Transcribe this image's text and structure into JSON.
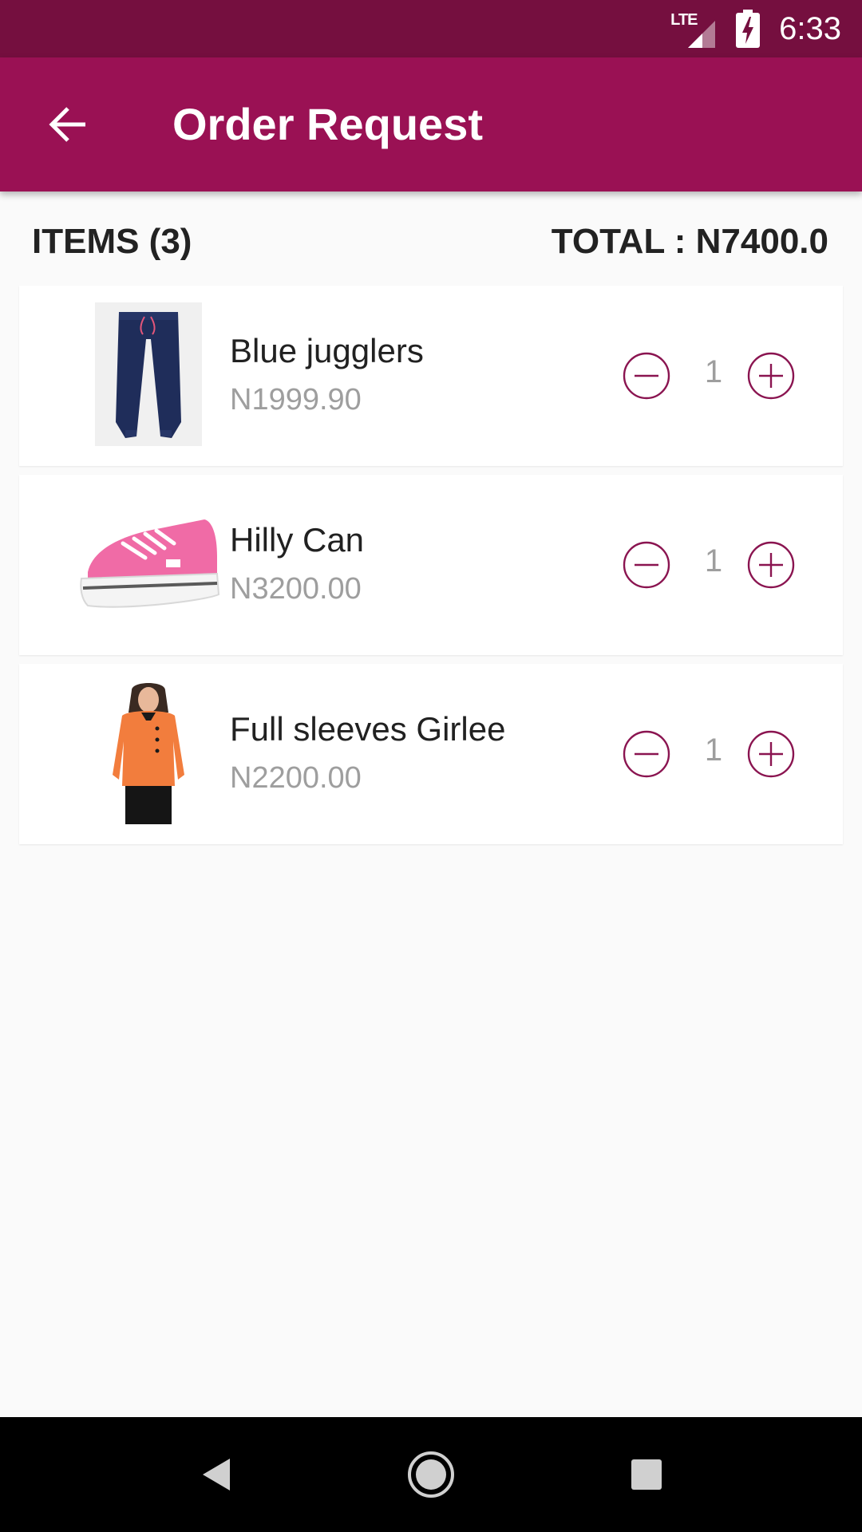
{
  "status_bar": {
    "network": "LTE",
    "time": "6:33"
  },
  "app_bar": {
    "title": "Order Request",
    "back_icon": "arrow-back-icon"
  },
  "summary": {
    "items_label": "ITEMS (3)",
    "total_label": "TOTAL : N7400.0"
  },
  "cart": {
    "items": [
      {
        "name": "Blue jugglers",
        "price": "N1999.90",
        "quantity": "1",
        "image": "navy-joggers-image"
      },
      {
        "name": "Hilly Can",
        "price": "N3200.00",
        "quantity": "1",
        "image": "pink-sneaker-image"
      },
      {
        "name": "Full sleeves Girlee",
        "price": "N2200.00",
        "quantity": "1",
        "image": "orange-top-image"
      }
    ]
  },
  "colors": {
    "status_bar": "#750F3F",
    "app_bar": "#9A1154",
    "accent": "#8A1450",
    "background": "#FAFAFA"
  },
  "icons": {
    "decrease": "minus-circle-icon",
    "increase": "plus-circle-icon",
    "nav_back": "triangle-back-icon",
    "nav_home": "circle-home-icon",
    "nav_recents": "square-recents-icon"
  }
}
